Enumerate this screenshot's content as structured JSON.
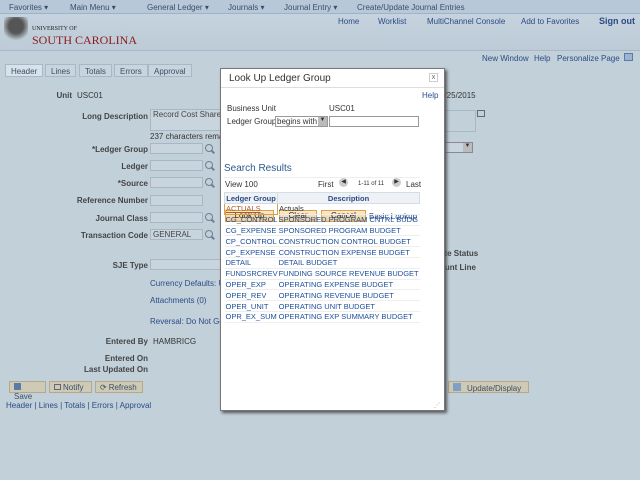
{
  "nav": {
    "favorites": "Favorites ▾",
    "main_menu": "Main Menu ▾",
    "crumbs": [
      "General Ledger ▾",
      "Journals ▾",
      "Journal Entry ▾",
      "Create/Update Journal Entries"
    ]
  },
  "header": {
    "logo_line1": "UNIVERSITY OF",
    "logo_line2": "SOUTH CAROLINA",
    "links": [
      "Home",
      "Worklist",
      "MultiChannel Console",
      "Add to Favorites"
    ],
    "sign_out": "Sign out"
  },
  "page_links": [
    "New Window",
    "Help",
    "Personalize Page"
  ],
  "tabs": [
    "Header",
    "Lines",
    "Totals",
    "Errors",
    "Approval"
  ],
  "form": {
    "unit_label": "Unit",
    "unit_value": "USC01",
    "date_partial": "5/25/2015",
    "long_desc_label": "Long Description",
    "long_desc_value": "Record Cost Share",
    "chars_remaining": "237 characters rema",
    "ledger_group_label": "*Ledger Group",
    "ledger_label": "Ledger",
    "source_label": "*Source",
    "reference_label": "Reference Number",
    "journal_class_label": "Journal Class",
    "transaction_code_label": "Transaction Code",
    "transaction_code_value": "GENERAL",
    "sje_type_label": "SJE Type",
    "currency_defaults": "Currency Defaults: U",
    "attachments": "Attachments (0)",
    "reversal": "Reversal: Do Not Ge",
    "entered_by_label": "Entered By",
    "entered_by_value": "HAMBRICG",
    "entered_on_label": "Entered On",
    "last_updated_label": "Last Updated On",
    "status_partial": "ete Status",
    "line_partial": "ount Line"
  },
  "buttons": {
    "save": "Save",
    "notify": "Notify",
    "refresh": "Refresh",
    "update_display": "Update/Display"
  },
  "footer_links": [
    "Header",
    "Lines",
    "Totals",
    "Errors",
    "Approval"
  ],
  "modal": {
    "title": "Look Up Ledger Group",
    "close": "x",
    "help": "Help",
    "bu_label": "Business Unit",
    "bu_value": "USC01",
    "lg_label": "Ledger Group",
    "operator": "begins with",
    "search_value": "",
    "lookup": "Look Up",
    "clear": "Clear",
    "cancel": "Cancel",
    "basic_lookup": "Basic Lookup",
    "results_title": "Search Results",
    "view_all": "View 100",
    "first": "First",
    "range": "1-11 of 11",
    "last": "Last",
    "columns": [
      "Ledger Group",
      "Description"
    ],
    "rows": [
      [
        "ACTUALS",
        "Actuals"
      ],
      [
        "CG_CONTROL",
        "SPONSORED PROGRAM CNTRL BUDG"
      ],
      [
        "CG_EXPENSE",
        "SPONSORED PROGRAM BUDGET"
      ],
      [
        "CP_CONTROL",
        "CONSTRUCTION CONTROL BUDGET"
      ],
      [
        "CP_EXPENSE",
        "CONSTRUCTION EXPENSE BUDGET"
      ],
      [
        "DETAIL",
        "DETAIL BUDGET"
      ],
      [
        "FUNDSRCREV",
        "FUNDING SOURCE REVENUE BUDGET"
      ],
      [
        "OPER_EXP",
        "OPERATING EXPENSE BUDGET"
      ],
      [
        "OPER_REV",
        "OPERATING REVENUE BUDGET"
      ],
      [
        "OPER_UNIT",
        "OPERATING UNIT BUDGET"
      ],
      [
        "OPR_EX_SUM",
        "OPERATING EXP SUMMARY BUDGET"
      ]
    ]
  }
}
